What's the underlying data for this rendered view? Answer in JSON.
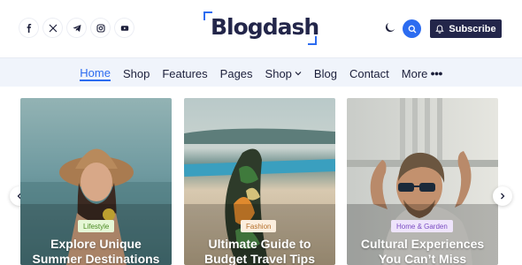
{
  "brand": {
    "name": "Blogdash"
  },
  "socials": [
    {
      "name": "facebook-icon",
      "glyph": "f"
    },
    {
      "name": "x-icon",
      "glyph": "𝕏"
    },
    {
      "name": "telegram-icon",
      "glyph": ""
    },
    {
      "name": "instagram-icon",
      "glyph": ""
    },
    {
      "name": "youtube-icon",
      "glyph": ""
    }
  ],
  "header": {
    "subscribe_label": "Subscribe"
  },
  "nav": {
    "items": [
      {
        "label": "Home",
        "active": true
      },
      {
        "label": "Shop"
      },
      {
        "label": "Features"
      },
      {
        "label": "Pages"
      },
      {
        "label": "Shop",
        "dropdown": true
      },
      {
        "label": "Blog"
      },
      {
        "label": "Contact"
      },
      {
        "label": "More"
      }
    ]
  },
  "cards": [
    {
      "tag": "Lifestyle",
      "title_line1": "Explore Unique",
      "title_line2": "Summer Destinations"
    },
    {
      "tag": "Fashion",
      "title_line1": "Ultimate Guide to",
      "title_line2": "Budget Travel Tips"
    },
    {
      "tag": "Home & Garden",
      "title_line1": "Cultural Experiences",
      "title_line2": "You Can’t Miss"
    }
  ],
  "colors": {
    "accent": "#2c6cf0",
    "navy": "#23264a",
    "tag_lifestyle_bg": "#e6f7d6",
    "tag_lifestyle_fg": "#4b8a23",
    "tag_fashion_bg": "#fbeede",
    "tag_fashion_fg": "#b5702c",
    "tag_home_bg": "#eee4fb",
    "tag_home_fg": "#7a4cc2"
  }
}
